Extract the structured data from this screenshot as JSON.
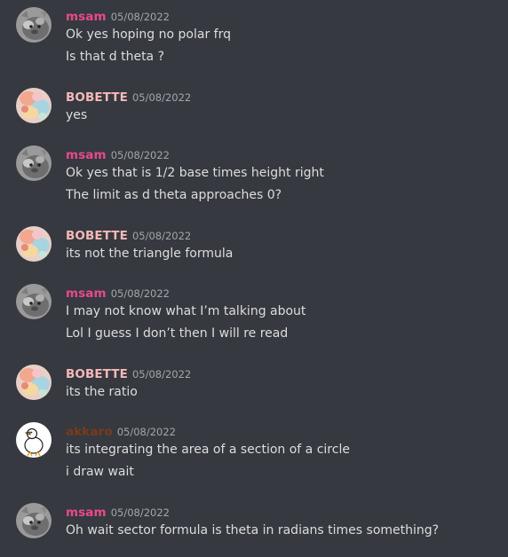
{
  "colors": {
    "background": "#36393f",
    "msam": "#e84a8a",
    "bobette": "#f5b8b8",
    "akkaro": "#7a3a1c",
    "text": "#dcddde",
    "timestamp": "#a3a6aa"
  },
  "messages": [
    {
      "author": "msam",
      "time": "05/08/2022",
      "avatar": "gray-cat-avatar",
      "lines": [
        "Ok yes hoping no polar frq",
        "Is that d theta ?"
      ]
    },
    {
      "author": "BOBETTE",
      "time": "05/08/2022",
      "avatar": "pastel-avatar",
      "lines": [
        "yes"
      ]
    },
    {
      "author": "msam",
      "time": "05/08/2022",
      "avatar": "gray-cat-avatar",
      "lines": [
        "Ok yes that is 1/2 base times height right",
        "The limit as d theta approaches 0?"
      ]
    },
    {
      "author": "BOBETTE",
      "time": "05/08/2022",
      "avatar": "pastel-avatar",
      "lines": [
        "its not the triangle formula"
      ]
    },
    {
      "author": "msam",
      "time": "05/08/2022",
      "avatar": "gray-cat-avatar",
      "lines": [
        "I may not know what I’m talking about",
        "Lol I guess I don’t then I will re read"
      ]
    },
    {
      "author": "BOBETTE",
      "time": "05/08/2022",
      "avatar": "pastel-avatar",
      "lines": [
        "its the ratio"
      ]
    },
    {
      "author": "akkaro",
      "time": "05/08/2022",
      "avatar": "duck-avatar",
      "lines": [
        "its integrating the area of a section of a circle",
        "i draw wait"
      ]
    },
    {
      "author": "msam",
      "time": "05/08/2022",
      "avatar": "gray-cat-avatar",
      "lines": [
        "Oh wait sector formula is theta in radians times something?"
      ]
    }
  ]
}
